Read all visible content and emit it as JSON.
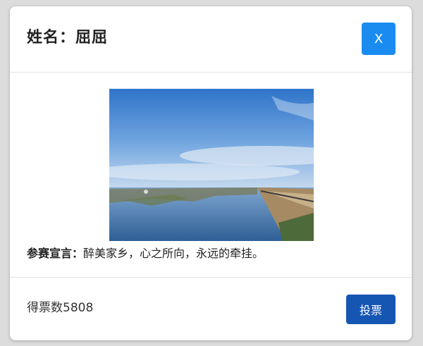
{
  "modal": {
    "title_prefix": "姓名：",
    "name": "屈屈",
    "close_label": "X"
  },
  "body": {
    "declaration_label": "参赛宣言：",
    "declaration_text": "醉美家乡，心之所向，永远的牵挂。"
  },
  "footer": {
    "votes_prefix": "得票数",
    "votes_count": "5808",
    "vote_button_label": "投票"
  },
  "colors": {
    "close_button": "#1a8cf0",
    "vote_button": "#1656b3"
  }
}
